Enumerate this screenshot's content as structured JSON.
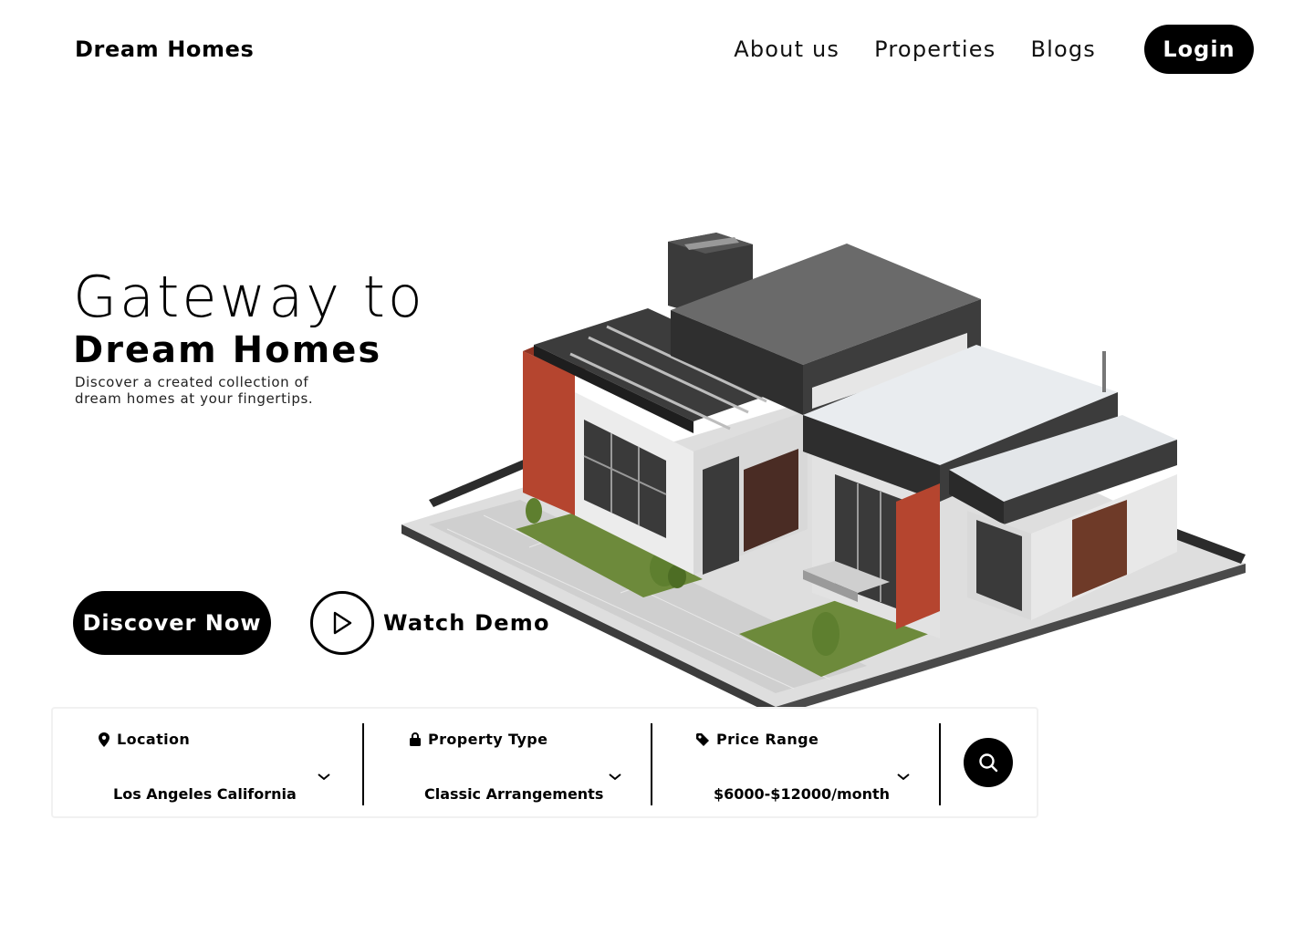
{
  "brand": {
    "name": "Dream Homes"
  },
  "nav": {
    "links": [
      "About us",
      "Properties",
      "Blogs"
    ],
    "login_label": "Login"
  },
  "hero": {
    "title_line1": "Gateway to",
    "title_line2": "Dream Homes",
    "subtitle": "Discover a created collection of dream homes at your fingertips.",
    "primary_cta": "Discover Now",
    "secondary_cta": "Watch Demo",
    "image_alt": "isometric-modern-house"
  },
  "search": {
    "location": {
      "label": "Location",
      "value": "Los Angeles California",
      "icon": "map-pin-icon"
    },
    "property_type": {
      "label": "Property Type",
      "value": "Classic Arrangements",
      "icon": "lock-icon"
    },
    "price_range": {
      "label": "Price Range",
      "value": "$6000-$12000/month",
      "icon": "price-tag-icon"
    },
    "search_icon": "search-icon"
  },
  "colors": {
    "primary": "#000000",
    "background": "#ffffff",
    "accent_red": "#b5452f",
    "grass": "#6d8a3b"
  }
}
